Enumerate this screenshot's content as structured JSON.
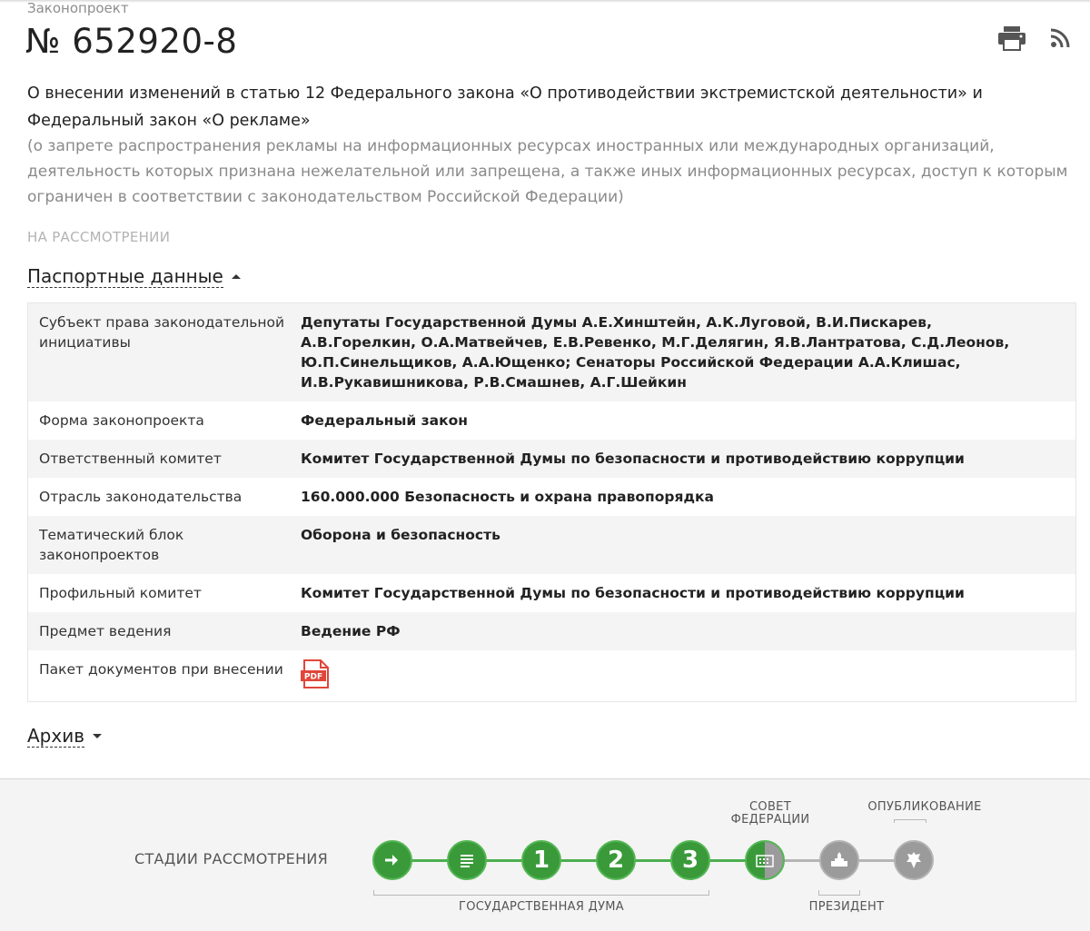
{
  "header": {
    "breadcrumb": "Законопроект",
    "bill_number": "№ 652920-8"
  },
  "title": "О внесении изменений в статью 12 Федерального закона «О противодействии экстремистской деятельности» и Федеральный закон «О рекламе»",
  "subtitle": "(о запрете распространения рекламы на информационных ресурсах иностранных или международных организаций, деятельность которых признана нежелательной или запрещена, а также иных информационных ресурсах, доступ к которым ограничен в соответствии с законодательством Российской Федерации)",
  "status": "НА РАССМОТРЕНИИ",
  "passport": {
    "toggle_label": "Паспортные данные",
    "rows": [
      {
        "key": "Субъект права законодательной инициативы",
        "value": "Депутаты Государственной Думы А.Е.Хинштейн, А.К.Луговой, В.И.Пискарев, А.В.Горелкин, О.А.Матвейчев, Е.В.Ревенко, М.Г.Делягин, Я.В.Лантратова, С.Д.Леонов, Ю.П.Синельщиков, А.А.Ющенко; Сенаторы Российской Федерации А.А.Клишас, И.В.Рукавишникова, Р.В.Смашнев, А.Г.Шейкин"
      },
      {
        "key": "Форма законопроекта",
        "value": "Федеральный закон"
      },
      {
        "key": "Ответственный комитет",
        "value": "Комитет Государственной Думы по безопасности и противодействию коррупции"
      },
      {
        "key": "Отрасль законодательства",
        "value": "160.000.000 Безопасность и охрана правопорядка"
      },
      {
        "key": "Тематический блок законопроектов",
        "value": "Оборона и безопасность"
      },
      {
        "key": "Профильный комитет",
        "value": "Комитет Государственной Думы по безопасности и противодействию коррупции"
      },
      {
        "key": "Предмет ведения",
        "value": "Ведение РФ"
      },
      {
        "key": "Пакет документов при внесении",
        "value": ""
      }
    ],
    "pdf_label": "PDF"
  },
  "archive": {
    "toggle_label": "Архив"
  },
  "stages": {
    "label": "СТАДИИ РАССМОТРЕНИЯ",
    "reading_numbers": [
      "1",
      "2",
      "3"
    ],
    "council_label": "СОВЕТ ФЕДЕРАЦИИ",
    "publication_label": "ОПУБЛИКОВАНИЕ",
    "duma_label": "ГОСУДАРСТВЕННАЯ ДУМА",
    "president_label": "ПРЕЗИДЕНТ",
    "colors": {
      "done": "#3a9a3a",
      "pending": "#9b9b9b",
      "line_done": "#4caf50",
      "line_pending": "#b5b5b5"
    }
  },
  "colors": {
    "pdf_red": "#e0463a"
  }
}
